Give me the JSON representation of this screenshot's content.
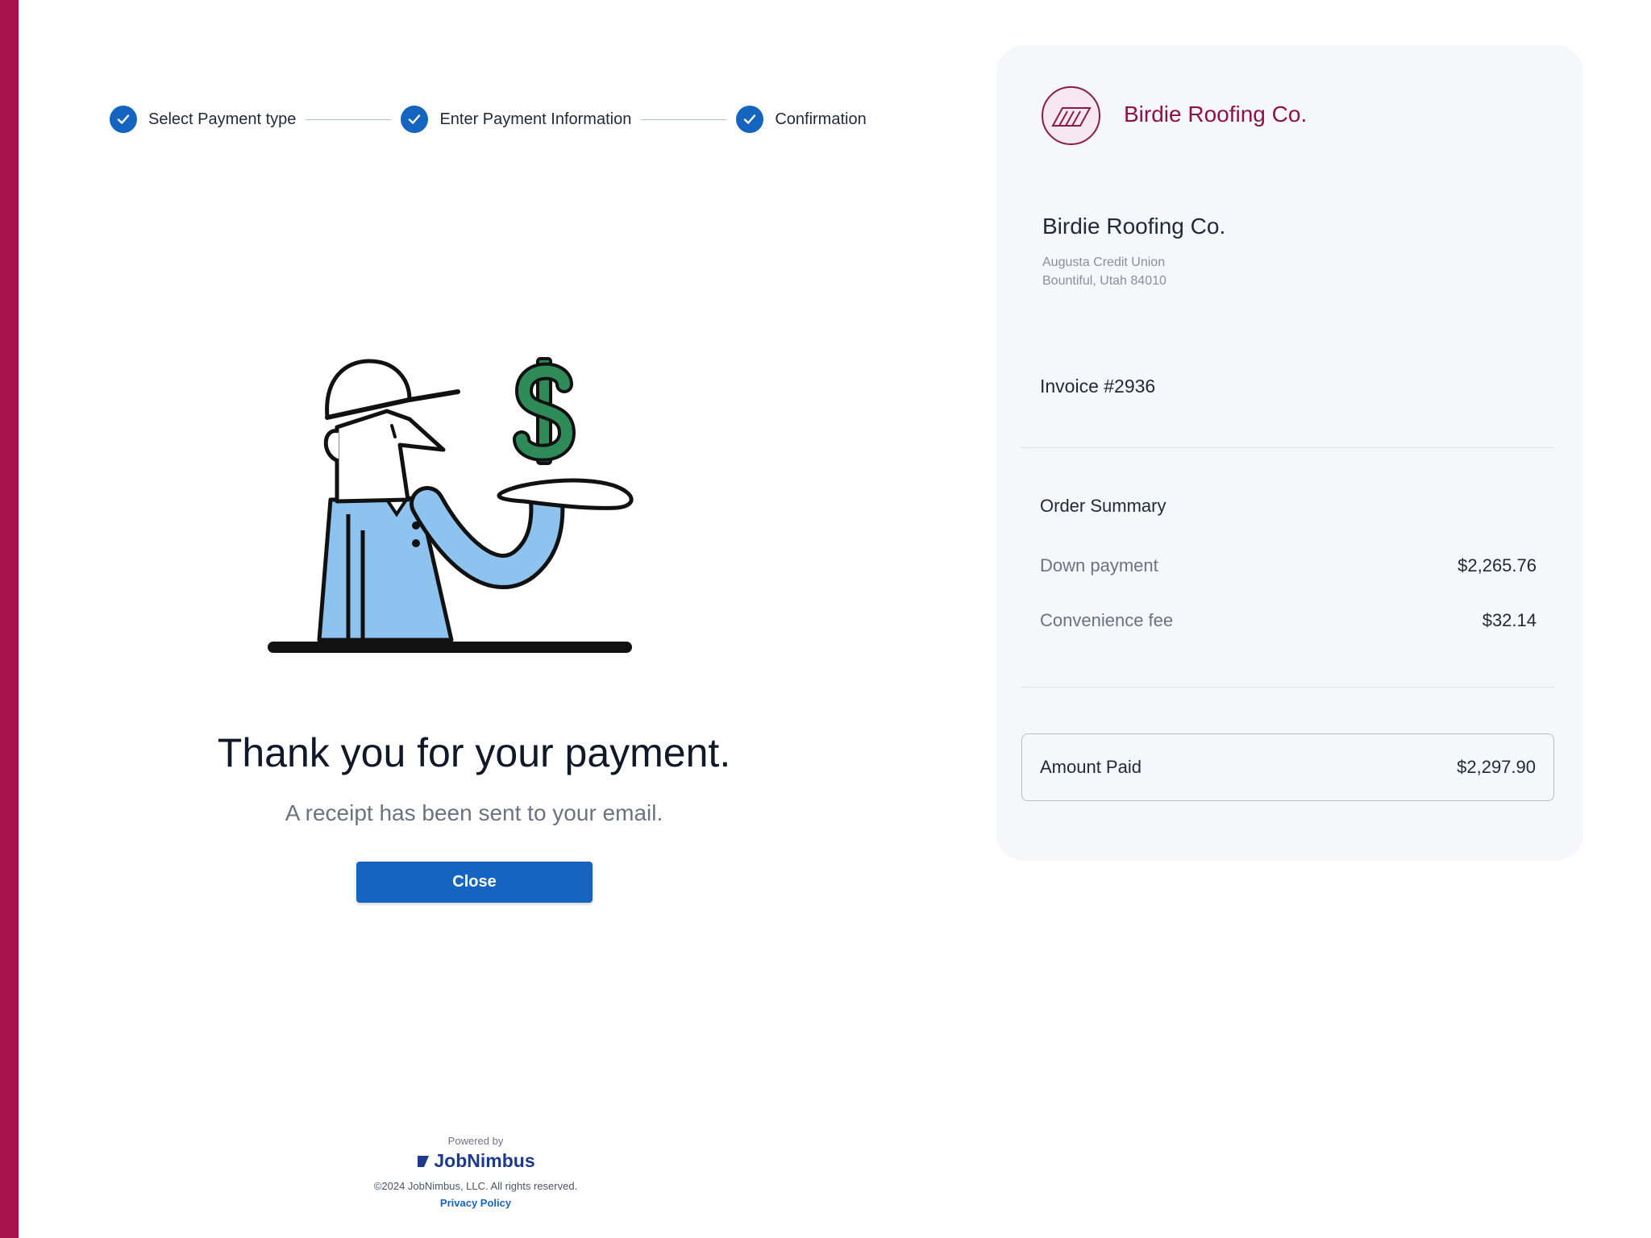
{
  "steps": [
    {
      "label": "Select Payment type",
      "status": "complete"
    },
    {
      "label": "Enter Payment Information",
      "status": "complete"
    },
    {
      "label": "Confirmation",
      "status": "complete"
    }
  ],
  "main": {
    "heading": "Thank you for your payment.",
    "subheading": "A receipt has been sent to your email.",
    "close_label": "Close"
  },
  "footer": {
    "powered_by": "Powered by",
    "logo_text": "JobNimbus",
    "copyright": "©2024 JobNimbus, LLC. All rights reserved.",
    "privacy_link": "Privacy Policy"
  },
  "summary": {
    "brand_name": "Birdie Roofing Co.",
    "company_name": "Birdie Roofing Co.",
    "address_line1": "Augusta Credit Union",
    "address_line2": "Bountiful, Utah 84010",
    "invoice": "Invoice #2936",
    "order_title": "Order Summary",
    "items": [
      {
        "label": "Down payment",
        "value": "$2,265.76"
      },
      {
        "label": "Convenience fee",
        "value": "$32.14"
      }
    ],
    "amount_paid_label": "Amount Paid",
    "amount_paid_value": "$2,297.90"
  },
  "colors": {
    "accent": "#1565c0",
    "brand": "#a8124f",
    "money_green": "#2e8b57",
    "shirt_blue": "#8ec3ef"
  }
}
